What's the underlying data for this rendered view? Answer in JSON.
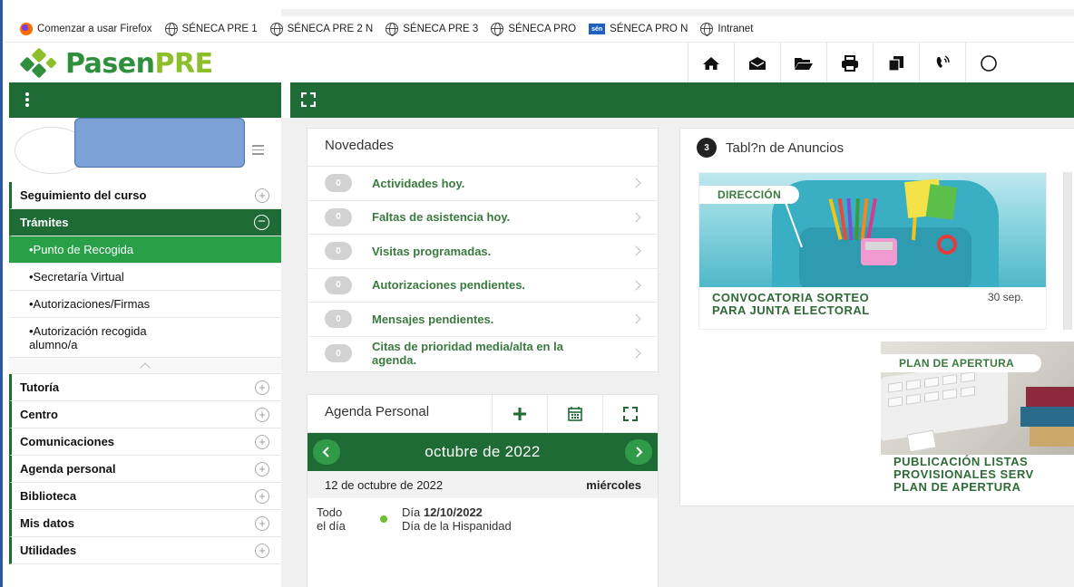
{
  "bookmarks": [
    {
      "label": "Comenzar a usar Firefox",
      "icon": "firefox-icon"
    },
    {
      "label": "SÉNECA PRE 1",
      "icon": "globe-icon"
    },
    {
      "label": "SÉNECA PRE 2 N",
      "icon": "globe-icon"
    },
    {
      "label": "SÉNECA PRE 3",
      "icon": "globe-icon"
    },
    {
      "label": "SÉNECA PRO",
      "icon": "globe-icon"
    },
    {
      "label": "SÉNECA PRO N",
      "icon": "seneca-icon",
      "icon_text": "sén"
    },
    {
      "label": "Intranet",
      "icon": "globe-icon"
    }
  ],
  "header": {
    "logo_main": "Pasen",
    "logo_accent": "PRE",
    "icons": [
      "home-icon",
      "envelope-icon",
      "folder-icon",
      "print-icon",
      "copy-icon",
      "phone-icon"
    ]
  },
  "sidebar": {
    "items": [
      {
        "label": "Seguimiento del curso"
      },
      {
        "label": "Trámites"
      },
      {
        "label": "Tutoría"
      },
      {
        "label": "Centro"
      },
      {
        "label": "Comunicaciones"
      },
      {
        "label": "Agenda personal"
      },
      {
        "label": "Biblioteca"
      },
      {
        "label": "Mis datos"
      },
      {
        "label": "Utilidades"
      }
    ],
    "subitems": [
      "•Punto de Recogida",
      "•Secretaría Virtual",
      "•Autorizaciones/Firmas",
      "•Autorización recogida alumno/a"
    ]
  },
  "novedades": {
    "title": "Novedades",
    "rows": [
      {
        "count": "0",
        "label": "Actividades hoy."
      },
      {
        "count": "0",
        "label": "Faltas de asistencia hoy."
      },
      {
        "count": "0",
        "label": "Visitas programadas."
      },
      {
        "count": "0",
        "label": "Autorizaciones pendientes."
      },
      {
        "count": "0",
        "label": "Mensajes pendientes."
      },
      {
        "count": "0",
        "label": "Citas de prioridad media/alta en la agenda."
      }
    ]
  },
  "agenda": {
    "title": "Agenda Personal",
    "month": "octubre de 2022",
    "date": "12 de octubre de 2022",
    "weekday": "miércoles",
    "event": {
      "allday_1": "Todo",
      "allday_2": "el día",
      "day_prefix": "Día ",
      "day": "12/10/2022",
      "description": "Día de la Hispanidad"
    }
  },
  "tablon": {
    "count": "3",
    "title": "Tabl?n de Anuncios",
    "announcements": [
      {
        "tag": "DIRECCIÓN",
        "title_1": "CONVOCATORIA SORTEO",
        "title_2": "PARA JUNTA ELECTORAL",
        "date": "30 sep."
      },
      {
        "tag": "PLAN DE APERTURA",
        "title_1": "PUBLICACIÓN LISTAS",
        "title_2": "PROVISIONALES SERV",
        "title_3": "PLAN DE APERTURA"
      }
    ]
  },
  "colors": {
    "brand_green": "#1e6b35",
    "active_green": "#27a048",
    "logo_green": "#2f8f3d",
    "logo_lime": "#8dbf2a",
    "link_green": "#3a7a3f"
  }
}
